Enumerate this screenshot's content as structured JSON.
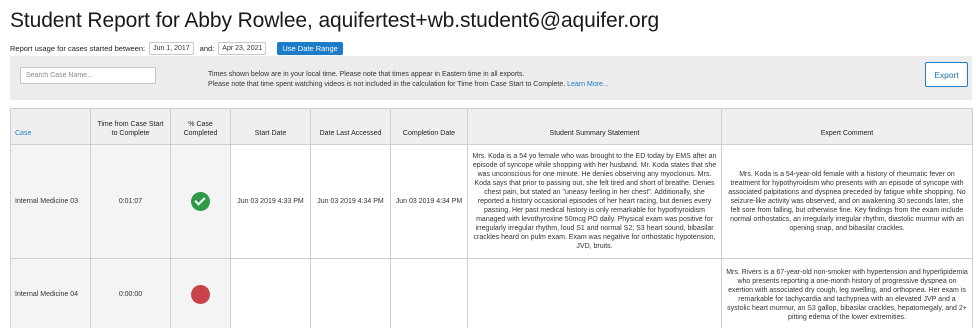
{
  "header": {
    "title": "Student Report for Abby Rowlee, aquifertest+wb.student6@aquifer.org"
  },
  "usage": {
    "label": "Report usage for cases started between:",
    "start_date": "Jun 1, 2017",
    "and_label": "and:",
    "end_date": "Apr 23, 2021",
    "button_label": "Use Date Range"
  },
  "toolbar": {
    "search_placeholder": "Search Case Name...",
    "note_line1": "Times shown below are in your local time. Please note that times appear in Eastern time in all exports.",
    "note_line2": "Please note that time spent watching videos is not included in the calculation for Time from Case Start to Complete.",
    "learn_more": "Learn More...",
    "export_label": "Export"
  },
  "table": {
    "headers": {
      "case": "Case",
      "time": "Time from Case Start to Complete",
      "pct": "% Case Completed",
      "start": "Start Date",
      "accessed": "Date Last Accessed",
      "completion": "Completion Date",
      "summary": "Student Summary Statement",
      "expert": "Expert Comment"
    },
    "rows": [
      {
        "case": "Internal Medicine 03",
        "time": "0:01:07",
        "status": "complete",
        "start": "Jun 03 2019 4:33 PM",
        "accessed": "Jun 03 2019 4:34 PM",
        "completion": "Jun 03 2019 4:34 PM",
        "summary": "Mrs. Koda is a 54 yo female who was brought to the ED today by EMS after an episode of syncope while shopping with her husband. Mr. Koda states that she was unconscious for one minute. He denies observing any myoclonus. Mrs. Koda says that prior to passing out, she felt tired and short of breathe. Denies chest pain, but stated an \"uneasy feeling in her chest\". Additionally, she reported a history occasional episodes of her heart racing, but denies every passing. Her past medical history is only remarkable for hypothyroidism managed with levothyroxine 50mcg PO daily. Physical exam was positive for irregularly irregular rhythm, loud S1 and normal S2; S3 heart sound, bibasilar crackles heard on pulm exam. Exam was negative for orthostatic hypotension, JVD, bruits.",
        "expert": "Mrs. Koda is a 54-year-old female with a history of rheumatic fever on treatment for hypothyroidism who presents with an episode of syncope with associated palpitations and dyspnea preceded by fatigue while shopping. No seizure-like activity was observed, and on awakening 30 seconds later, she felt sore from falling, but otherwise fine. Key findings from the exam include normal orthostatics, an irregularly irregular rhythm, diastolic murmur with an opening snap, and bibasilar crackles."
      },
      {
        "case": "Internal Medicine 04",
        "time": "0:00:00",
        "status": "incomplete",
        "start": "",
        "accessed": "",
        "completion": "",
        "summary": "",
        "expert": "Mrs. Rivers is a 67-year-old non-smoker with hypertension and hyperlipidemia who presents reporting a one-month history of progressive dyspnea on exertion with associated dry cough, leg swelling, and orthopnea. Her exam is remarkable for tachycardia and tachypnea with an elevated JVP and a systolic heart murmur, an S3 gallop, bibasilar crackles, hepatomegaly, and 2+ pitting edema of the lower extremities."
      }
    ]
  },
  "colors": {
    "accent": "#1c7cc7",
    "complete": "#2e9a48",
    "incomplete": "#c9434a",
    "toolbar_bg": "#ececec"
  },
  "icons": {
    "complete": "check-circle-icon",
    "incomplete": "red-dot-icon"
  }
}
